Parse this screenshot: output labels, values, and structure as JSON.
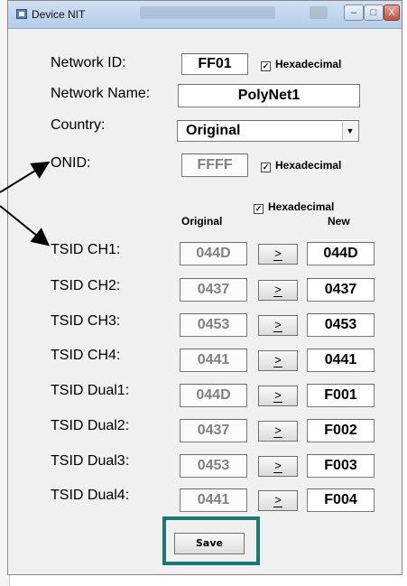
{
  "window": {
    "title": "Device NIT",
    "controls": {
      "minimize": "–",
      "maximize": "□",
      "close": "X"
    }
  },
  "form": {
    "network_id": {
      "label": "Network ID:",
      "value": "FF01",
      "hex_label": "Hexadecimal",
      "hex_checked": true
    },
    "network_name": {
      "label": "Network Name:",
      "value": "PolyNet1"
    },
    "country": {
      "label": "Country:",
      "value": "Original"
    },
    "onid": {
      "label": "ONID:",
      "value": "FFFF",
      "hex_label": "Hexadecimal",
      "hex_checked": true
    },
    "tsid_hex": {
      "label": "Hexadecimal",
      "checked": true
    },
    "columns": {
      "original": "Original",
      "new": "New"
    },
    "copy_label": ">",
    "tsid_rows": [
      {
        "label": "TSID CH1:",
        "original": "044D",
        "new": "044D"
      },
      {
        "label": "TSID CH2:",
        "original": "0437",
        "new": "0437"
      },
      {
        "label": "TSID CH3:",
        "original": "0453",
        "new": "0453"
      },
      {
        "label": "TSID CH4:",
        "original": "0441",
        "new": "0441"
      },
      {
        "label": "TSID Dual1:",
        "original": "044D",
        "new": "F001"
      },
      {
        "label": "TSID Dual2:",
        "original": "0437",
        "new": "F002"
      },
      {
        "label": "TSID Dual3:",
        "original": "0453",
        "new": "F003"
      },
      {
        "label": "TSID Dual4:",
        "original": "0441",
        "new": "F004"
      }
    ],
    "save_label": "Save"
  },
  "colors": {
    "highlight_frame": "#1a7a73"
  }
}
